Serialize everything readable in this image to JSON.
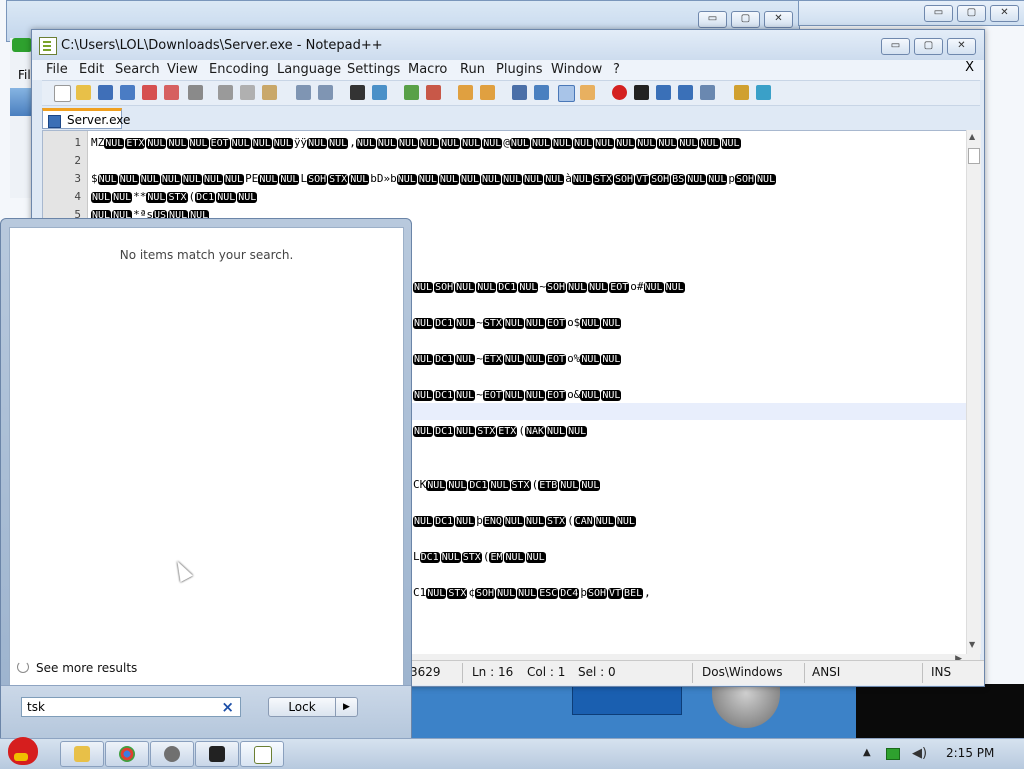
{
  "notepad": {
    "title": "C:\\Users\\LOL\\Downloads\\Server.exe - Notepad++",
    "caption_min": "▭",
    "caption_max": "▢",
    "caption_close": "✕",
    "close_doc": "X",
    "menu": [
      "File",
      "Edit",
      "Search",
      "View",
      "Encoding",
      "Language",
      "Settings",
      "Macro",
      "Run",
      "Plugins",
      "Window",
      "?"
    ],
    "tab_label": "Server.exe",
    "line_numbers": [
      "1",
      "2",
      "3",
      "4",
      "5"
    ],
    "status": {
      "length": "3629",
      "ln": "Ln : 16",
      "col": "Col : 1",
      "sel": "Sel : 0",
      "eol": "Dos\\Windows",
      "encoding": "ANSI",
      "mode": "INS"
    }
  },
  "start_menu": {
    "no_results": "No items match your search.",
    "see_more": "See more results",
    "search_value": "tsk",
    "lock_label": "Lock",
    "lock_arrow": "▶"
  },
  "taskbar": {
    "clock": "2:15 PM",
    "tray_arrow": "▲"
  },
  "background": {
    "menu_fragment": "Fil"
  },
  "colors": {
    "accent_blue": "#3c82c8",
    "control_char_bg": "#000000",
    "taskbar": "#c4d4e6"
  }
}
